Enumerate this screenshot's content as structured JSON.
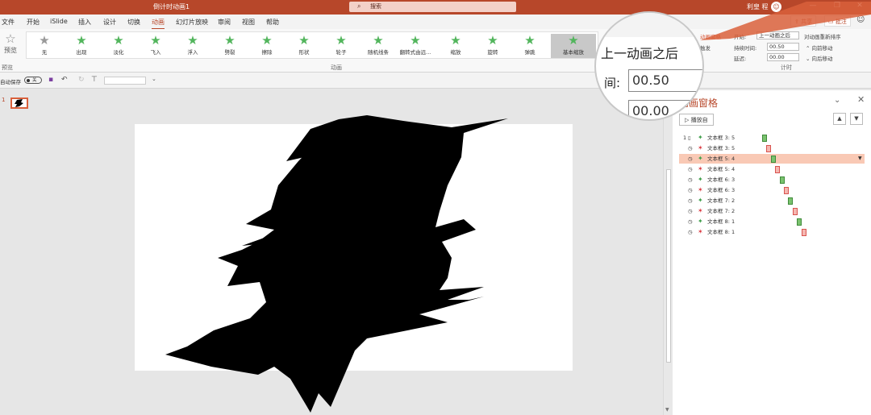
{
  "titlebar": {
    "title": "倒计时动画1",
    "search_placeholder": "搜索",
    "user": "利皇 程",
    "avatar_glyph": "☺",
    "min": "—",
    "restore": "❐",
    "close": "✕",
    "brand_color": "#b7472a"
  },
  "tabs": [
    "文件",
    "开始",
    "iSlide",
    "插入",
    "设计",
    "切换",
    "动画",
    "幻灯片放映",
    "审阅",
    "视图",
    "帮助"
  ],
  "active_tab": "动画",
  "header_buttons": {
    "share": "共享",
    "comment": "批注"
  },
  "ribbon": {
    "preview_label": "预览",
    "preview_group_label": "预览",
    "animation_group_label": "动画",
    "effects": [
      {
        "label": "无",
        "style": "gray"
      },
      {
        "label": "出现",
        "style": "green"
      },
      {
        "label": "淡化",
        "style": "green"
      },
      {
        "label": "飞入",
        "style": "green"
      },
      {
        "label": "浮入",
        "style": "green"
      },
      {
        "label": "劈裂",
        "style": "green"
      },
      {
        "label": "擦除",
        "style": "green"
      },
      {
        "label": "形状",
        "style": "green"
      },
      {
        "label": "轮子",
        "style": "green"
      },
      {
        "label": "随机线条",
        "style": "green"
      },
      {
        "label": "翻转式由远...",
        "style": "green"
      },
      {
        "label": "缩放",
        "style": "green"
      },
      {
        "label": "旋转",
        "style": "green"
      },
      {
        "label": "弹跳",
        "style": "green"
      },
      {
        "label": "基本缩放",
        "style": "selected"
      }
    ],
    "anim_pane_label": "动画窗格",
    "trigger_label": "触发",
    "start_label": "开始:",
    "start_value": "上一动画之后",
    "duration_label": "持续时间:",
    "duration_value": "00.50",
    "delay_label": "延迟:",
    "delay_value": "00.00",
    "reorder_title": "对动画重新排序",
    "move_earlier": "向前移动",
    "move_later": "向后移动",
    "timing_group_label": "计时"
  },
  "qat": {
    "autosave_label": "自动保存",
    "toggle_state": "关"
  },
  "thumbnail": {
    "number": "1"
  },
  "magnifier": {
    "start_text": "上一动画之后",
    "duration_label": "间:",
    "duration_value": "00.50",
    "delay_value": "00.00"
  },
  "anim_pane": {
    "title": "动画窗格",
    "play_button": "播放自",
    "up_arrow": "▲",
    "down_arrow": "▼",
    "items": [
      {
        "num": "1",
        "trigger": "click",
        "type": "in",
        "name": "文本框 3: 5",
        "offset": 0,
        "selected": false
      },
      {
        "num": "",
        "trigger": "after",
        "type": "out",
        "name": "文本框 3: 5",
        "offset": 1,
        "selected": false
      },
      {
        "num": "",
        "trigger": "after",
        "type": "in",
        "name": "文本框 5: 4",
        "offset": 2,
        "selected": true
      },
      {
        "num": "",
        "trigger": "after",
        "type": "out",
        "name": "文本框 5: 4",
        "offset": 3,
        "selected": false
      },
      {
        "num": "",
        "trigger": "after",
        "type": "in",
        "name": "文本框 6: 3",
        "offset": 4,
        "selected": false
      },
      {
        "num": "",
        "trigger": "after",
        "type": "out",
        "name": "文本框 6: 3",
        "offset": 5,
        "selected": false
      },
      {
        "num": "",
        "trigger": "after",
        "type": "in",
        "name": "文本框 7: 2",
        "offset": 6,
        "selected": false
      },
      {
        "num": "",
        "trigger": "after",
        "type": "out",
        "name": "文本框 7: 2",
        "offset": 7,
        "selected": false
      },
      {
        "num": "",
        "trigger": "after",
        "type": "in",
        "name": "文本框 8: 1",
        "offset": 8,
        "selected": false
      },
      {
        "num": "",
        "trigger": "after",
        "type": "out",
        "name": "文本框 8: 1",
        "offset": 9,
        "selected": false
      }
    ]
  }
}
